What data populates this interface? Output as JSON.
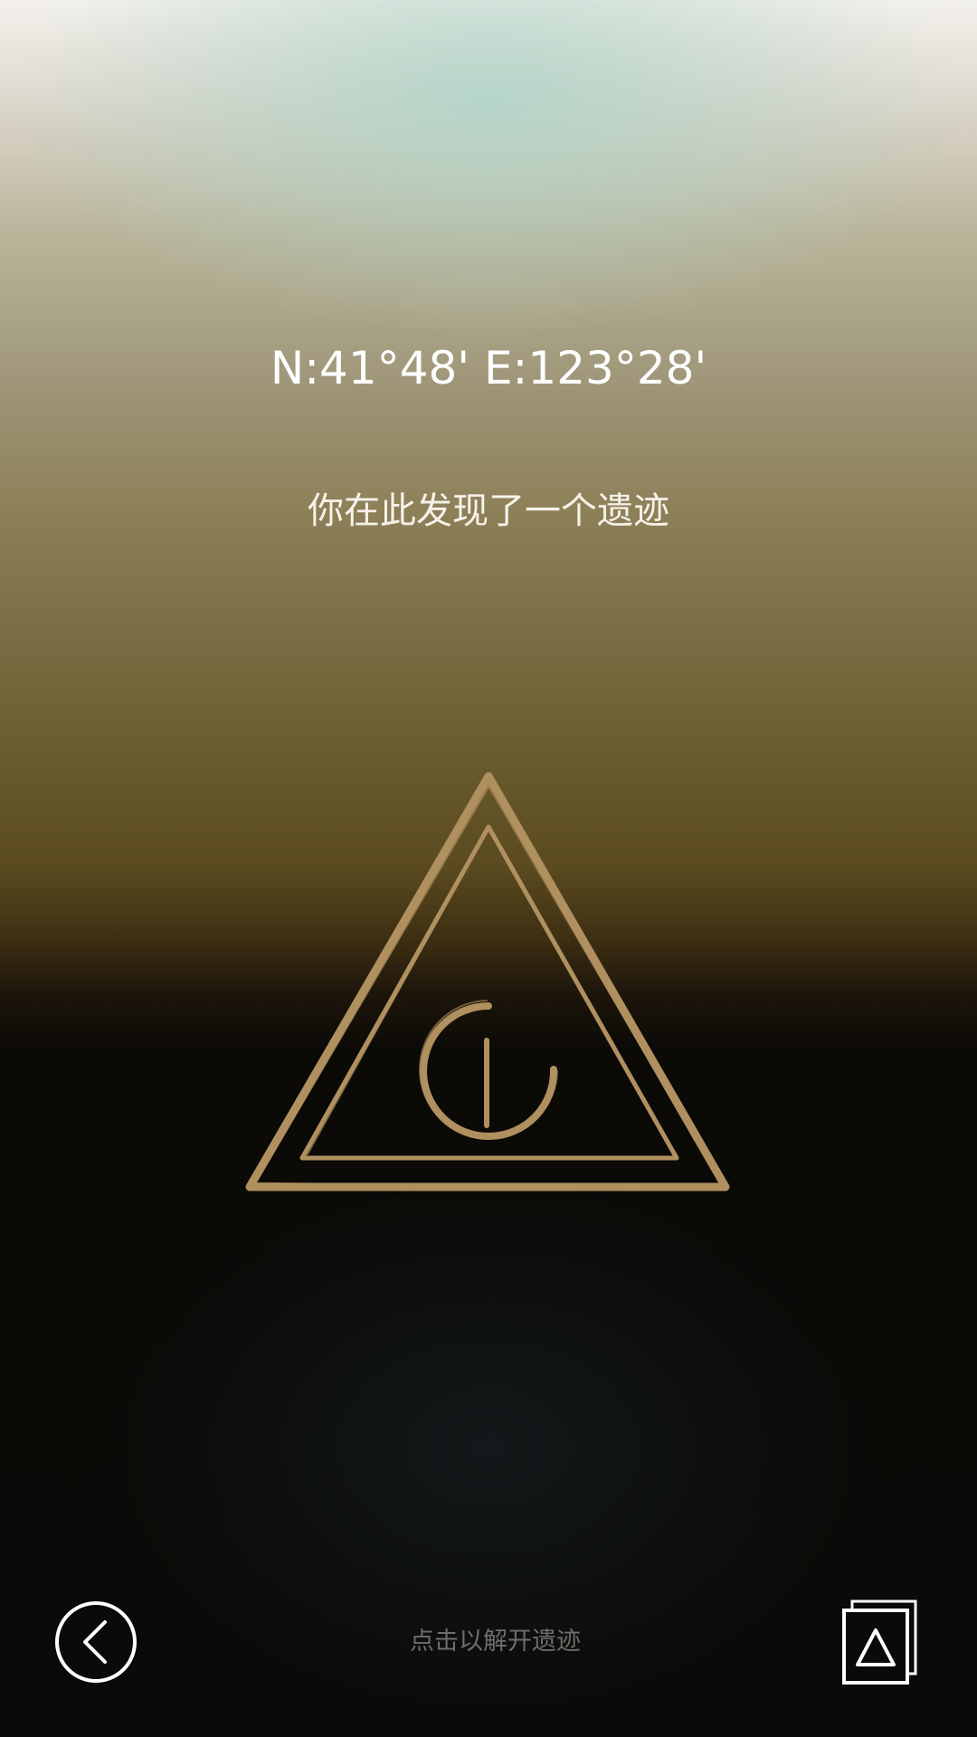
{
  "location": {
    "coordinates": "N:41°48' E:123°28'",
    "message": "你在此发现了一个遗迹"
  },
  "relic": {
    "icon": "triangle-eye-relic-icon",
    "color": "#b0905f"
  },
  "footer": {
    "back_icon": "back-arrow-icon",
    "hint": "点击以解开遗迹",
    "gallery_icon": "relic-collection-icon"
  }
}
